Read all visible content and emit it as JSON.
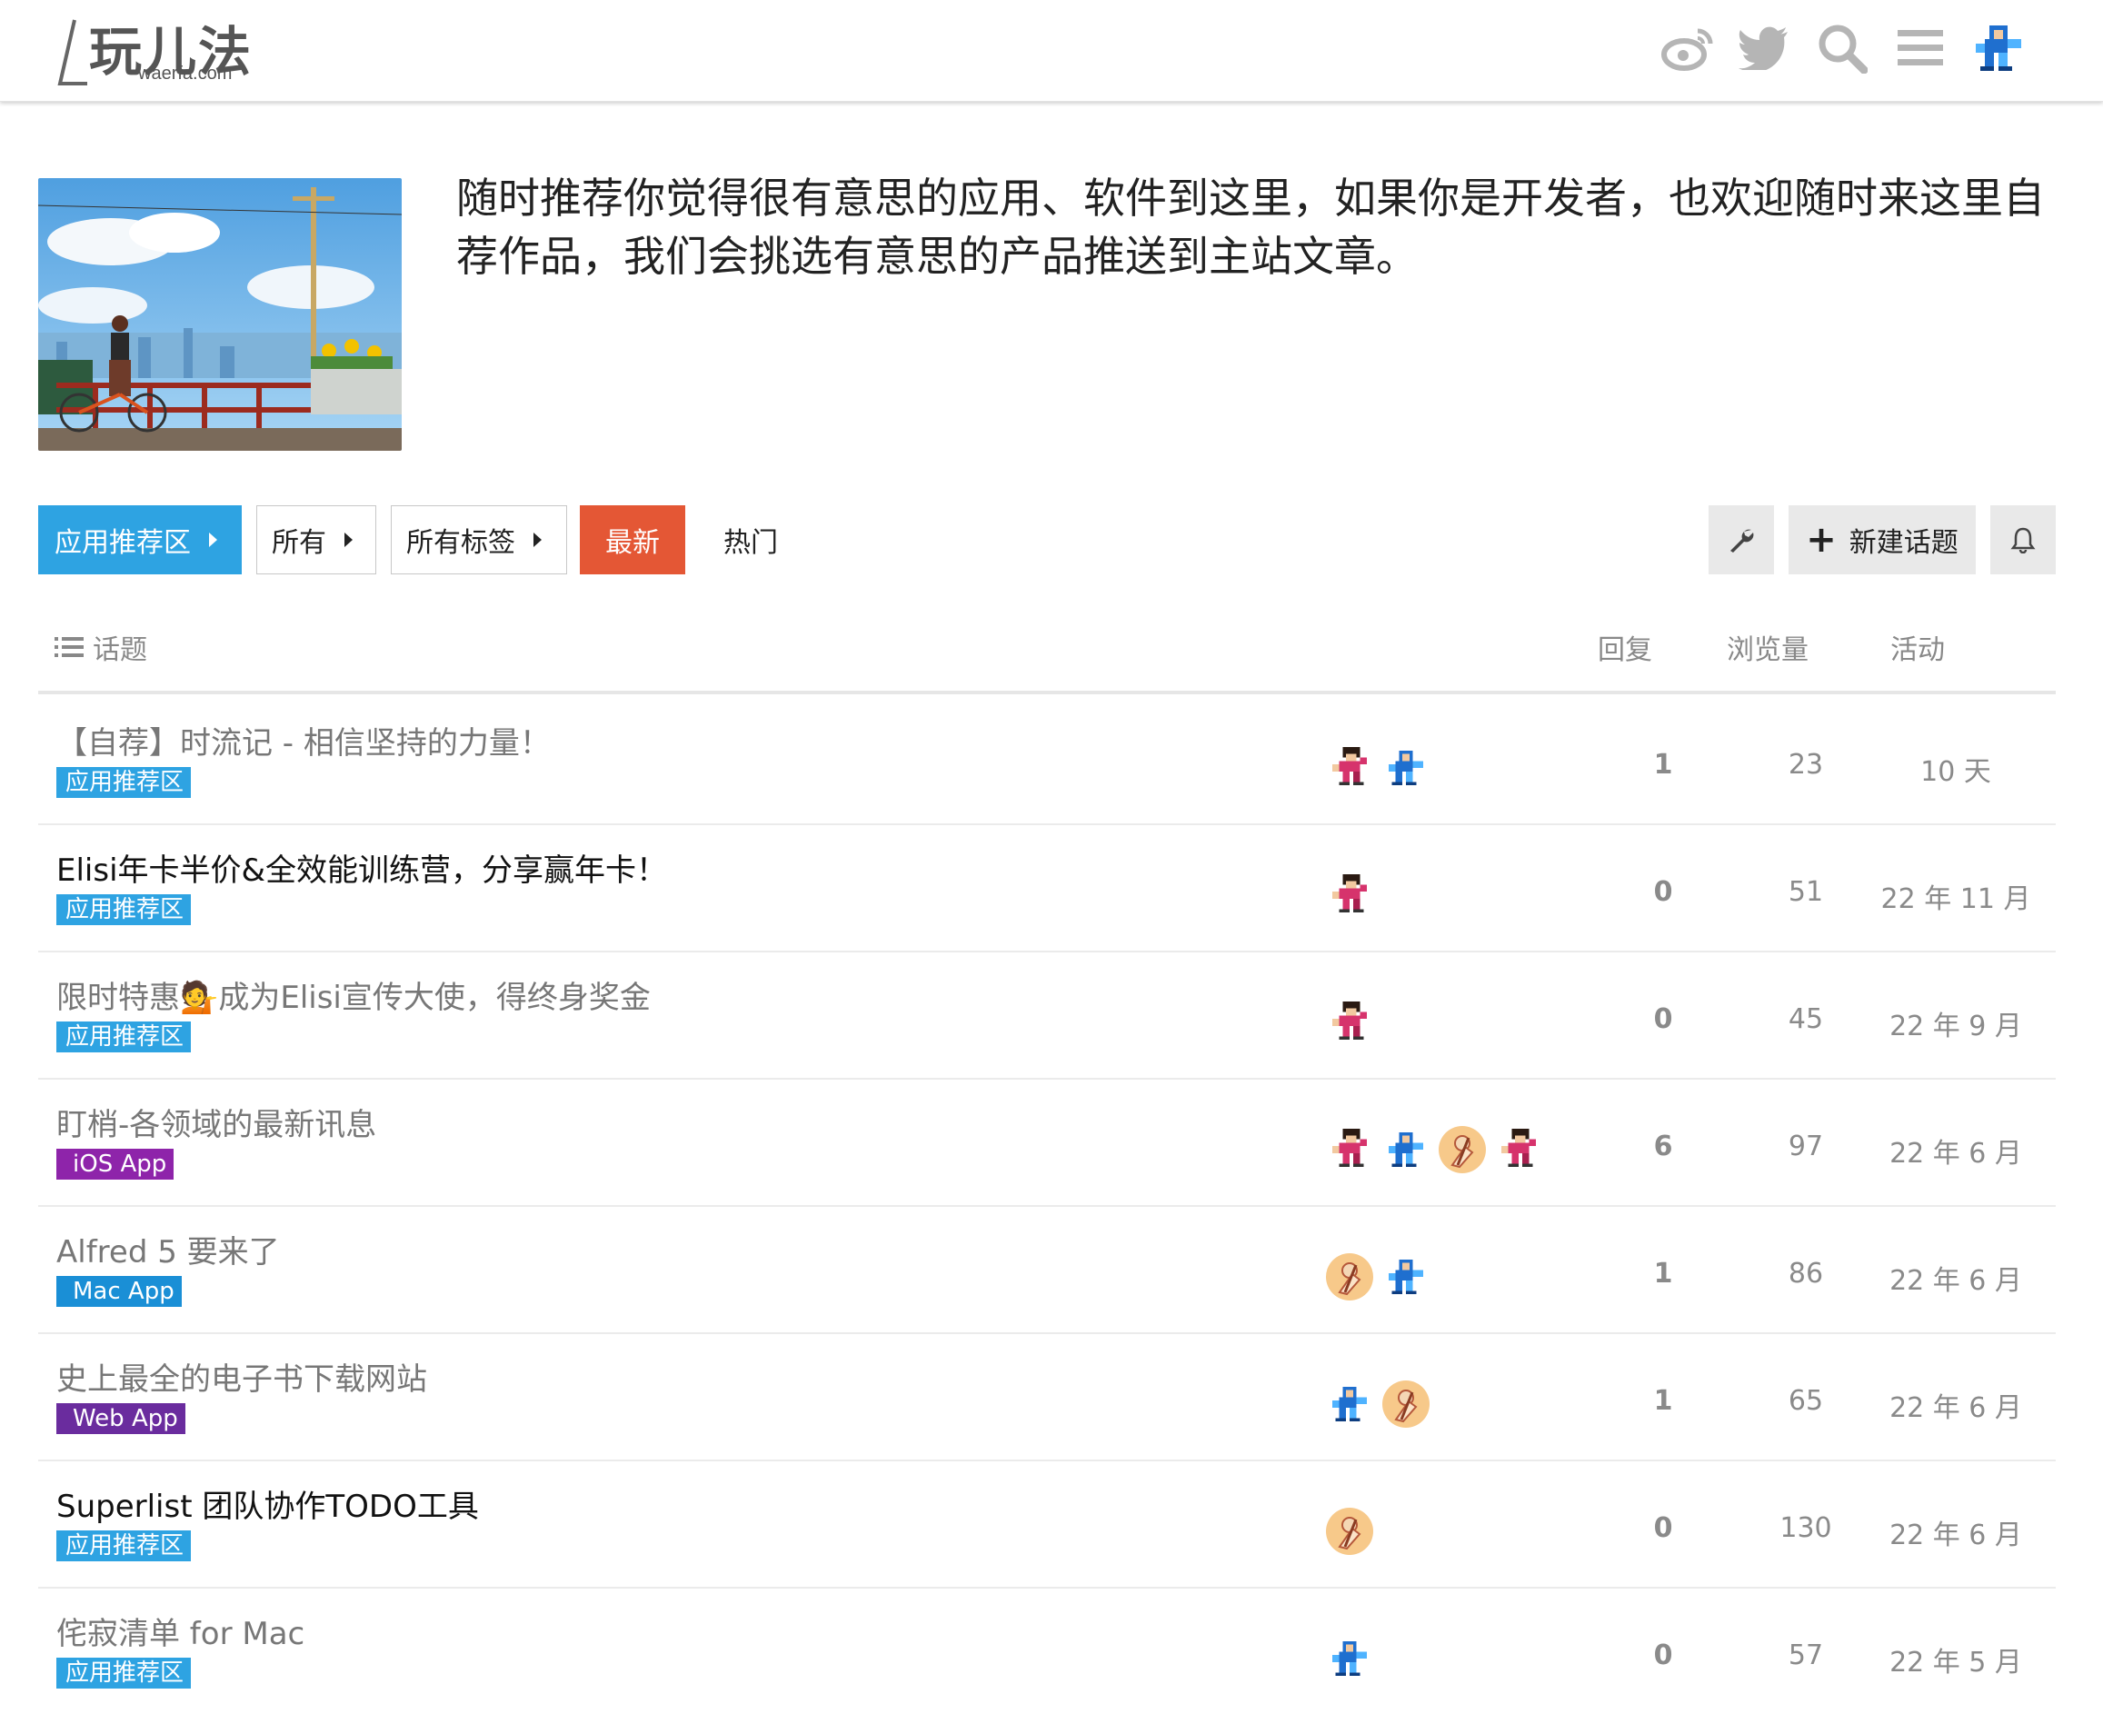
{
  "header": {
    "logo_title": "玩儿法",
    "logo_sub": "waerfa.com",
    "icons": [
      "weibo-icon",
      "twitter-icon",
      "search-icon",
      "menu-icon",
      "avatar"
    ]
  },
  "banner": {
    "text": "随时推荐你觉得很有意思的应用、软件到这里，如果你是开发者，也欢迎随时来这里自荐作品，我们会挑选有意思的产品推送到主站文章。"
  },
  "nav": {
    "category": "应用推荐区",
    "all": "所有",
    "all_tags": "所有标签",
    "latest": "最新",
    "hot": "热门",
    "new_topic": "新建话题"
  },
  "table": {
    "col_topic": "话题",
    "col_replies": "回复",
    "col_views": "浏览量",
    "col_activity": "活动"
  },
  "colors": {
    "accent": "#2ea3e2",
    "latest": "#e45735",
    "ios": "#8e24aa",
    "mac": "#1a8fd6",
    "web": "#6a2c9e"
  },
  "rows": [
    {
      "title": "【自荐】时流记 - 相信坚持的力量！",
      "unread": false,
      "badge": "应用推荐区",
      "badge_style": "cat",
      "avatars": [
        "pink",
        "blue"
      ],
      "replies": "1",
      "views": "23",
      "activity": "10 天"
    },
    {
      "title": "Elisi年卡半价&全效能训练营，分享赢年卡！",
      "unread": true,
      "badge": "应用推荐区",
      "badge_style": "cat",
      "avatars": [
        "pink"
      ],
      "replies": "0",
      "views": "51",
      "activity": "22 年 11 月"
    },
    {
      "title": "限时特惠💁成为Elisi宣传大使，得终身奖金",
      "unread": false,
      "badge": "应用推荐区",
      "badge_style": "cat",
      "avatars": [
        "pink"
      ],
      "replies": "0",
      "views": "45",
      "activity": "22 年 9 月"
    },
    {
      "title": "盯梢-各领域的最新讯息",
      "unread": false,
      "badge": "iOS App",
      "badge_style": "ios",
      "avatars": [
        "pink",
        "blue",
        "orange",
        "pink"
      ],
      "replies": "6",
      "views": "97",
      "activity": "22 年 6 月"
    },
    {
      "title": "Alfred 5 要来了",
      "unread": false,
      "badge": "Mac App",
      "badge_style": "mac",
      "avatars": [
        "orange",
        "blue"
      ],
      "replies": "1",
      "views": "86",
      "activity": "22 年 6 月"
    },
    {
      "title": "史上最全的电子书下载网站",
      "unread": false,
      "badge": "Web App",
      "badge_style": "web",
      "avatars": [
        "blue",
        "orange"
      ],
      "replies": "1",
      "views": "65",
      "activity": "22 年 6 月"
    },
    {
      "title": "Superlist 团队协作TODO工具",
      "unread": true,
      "badge": "应用推荐区",
      "badge_style": "cat",
      "avatars": [
        "orange"
      ],
      "replies": "0",
      "views": "130",
      "activity": "22 年 6 月"
    },
    {
      "title": "侘寂清单 for Mac",
      "unread": false,
      "badge": "应用推荐区",
      "badge_style": "cat",
      "avatars": [
        "blue"
      ],
      "replies": "0",
      "views": "57",
      "activity": "22 年 5 月"
    }
  ]
}
